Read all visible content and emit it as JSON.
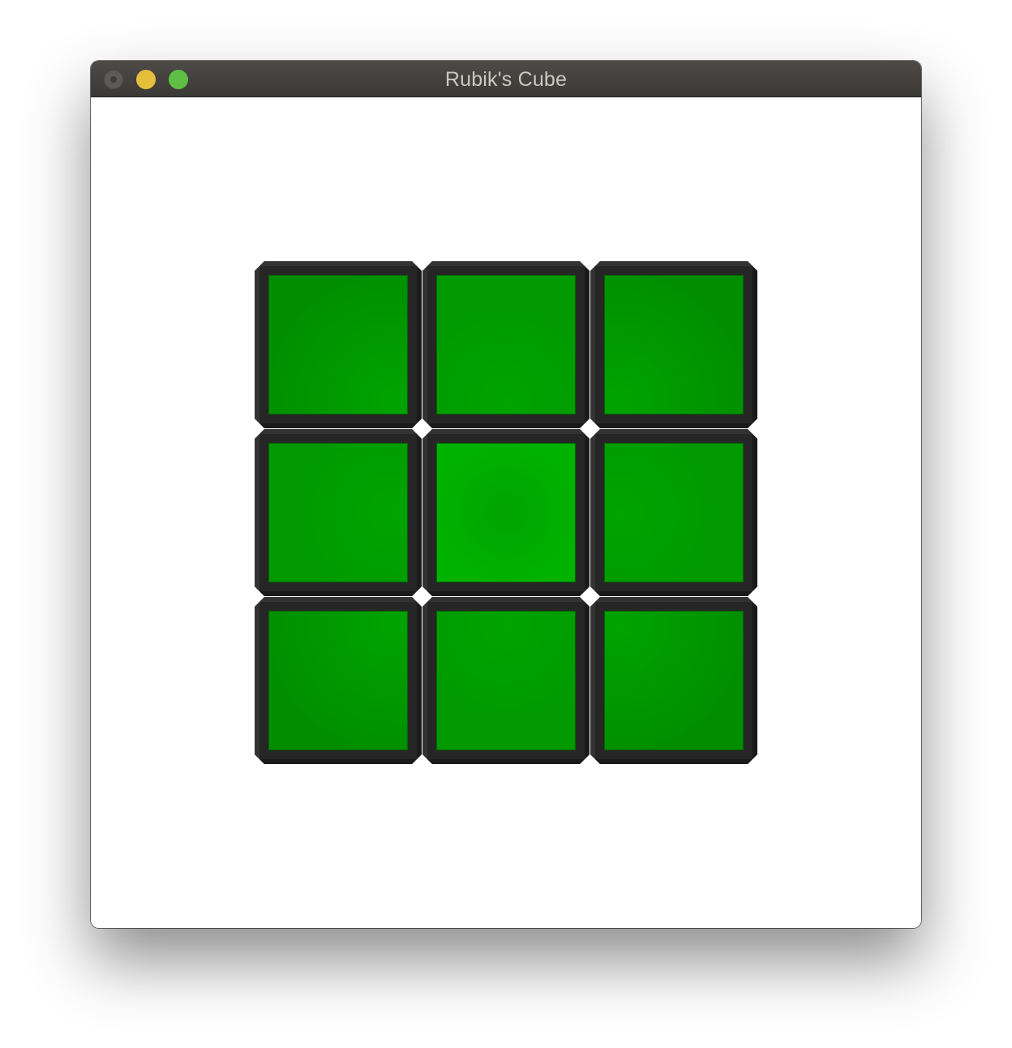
{
  "window": {
    "title": "Rubik's Cube"
  },
  "colors": {
    "accent": "#00a300",
    "center": "#00b200",
    "edge": "#009900",
    "corner": "#008e00",
    "frame": "#262626"
  },
  "cube": {
    "face_color": "green",
    "grid": [
      [
        "green",
        "green",
        "green"
      ],
      [
        "green",
        "green",
        "green"
      ],
      [
        "green",
        "green",
        "green"
      ]
    ]
  }
}
